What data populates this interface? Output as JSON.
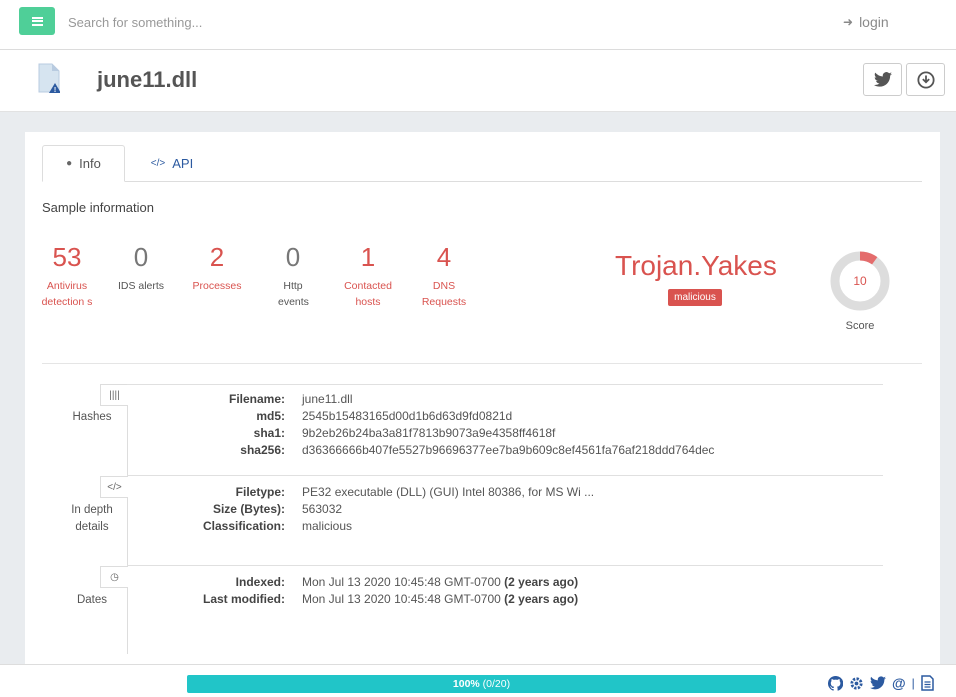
{
  "topbar": {
    "search_placeholder": "Search for something...",
    "login_label": "login"
  },
  "file": {
    "name": "june11.dll"
  },
  "tabs": [
    {
      "label": "Info"
    },
    {
      "label": "API"
    }
  ],
  "section_title": "Sample information",
  "stats": [
    {
      "value": "53",
      "label": "Antivirus detection s",
      "color": "#d9534f"
    },
    {
      "value": "0",
      "label": "IDS alerts",
      "color": "#777777"
    },
    {
      "value": "2",
      "label": "Processes",
      "color": "#d9534f"
    },
    {
      "value": "0",
      "label": "Http events",
      "color": "#777777"
    },
    {
      "value": "1",
      "label": "Contacted hosts",
      "color": "#d9534f"
    },
    {
      "value": "4",
      "label": "DNS Requests",
      "color": "#d9534f"
    }
  ],
  "threat": {
    "name": "Trojan.Yakes",
    "badge": "malicious"
  },
  "score": {
    "value": "10",
    "label": "Score",
    "fraction": 0.1
  },
  "hashes": {
    "label": "Hashes",
    "rows": [
      {
        "key": "Filename:",
        "value": "june11.dll"
      },
      {
        "key": "md5:",
        "value": "2545b15483165d00d1b6d63d9fd0821d"
      },
      {
        "key": "sha1:",
        "value": "9b2eb26b24ba3a81f7813b9073a9e4358ff4618f"
      },
      {
        "key": "sha256:",
        "value": "d36366666b407fe5527b96696377ee7ba9b609c8ef4561fa76af218ddd764dec"
      }
    ]
  },
  "details": {
    "label": "In depth details",
    "rows": [
      {
        "key": "Filetype:",
        "value": "PE32 executable (DLL) (GUI) Intel 80386, for MS Wi ..."
      },
      {
        "key": "Size (Bytes):",
        "value": "563032"
      },
      {
        "key": "Classification:",
        "value": "malicious"
      }
    ]
  },
  "dates": {
    "label": "Dates",
    "rows": [
      {
        "key": "Indexed:",
        "value": "Mon Jul 13 2020 10:45:48 GMT-0700",
        "ago": "(2 years ago)"
      },
      {
        "key": "Last modified:",
        "value": "Mon Jul 13 2020 10:45:48 GMT-0700",
        "ago": "(2 years ago)"
      }
    ]
  },
  "progress": {
    "percent": "100%",
    "count": "(0/20)",
    "fill": 1.0
  },
  "colors": {
    "accent_green": "#4fcf98",
    "danger": "#d9534f",
    "progress": "#21c5c8",
    "link": "#2c5aa0"
  },
  "footer_icons": [
    "github-icon",
    "settings-icon",
    "twitter-icon",
    "at-icon",
    "document-icon"
  ]
}
